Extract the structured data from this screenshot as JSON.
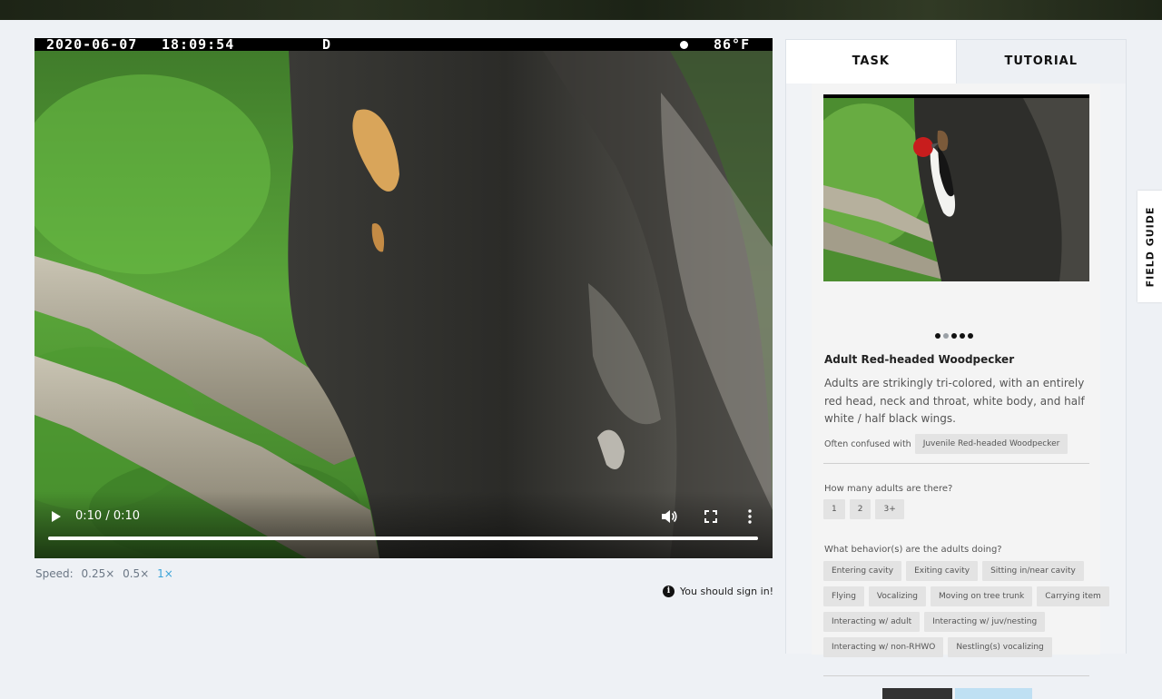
{
  "video": {
    "overlay": {
      "date": "2020-06-07",
      "time": "18:09:54",
      "mode": "D",
      "temperature": "86°F"
    },
    "player": {
      "time_display": "0:10 / 0:10",
      "progress": 1.0
    },
    "speed": {
      "label": "Speed:",
      "options": [
        "0.25×",
        "0.5×",
        "1×"
      ],
      "selected": "1×"
    }
  },
  "signin_notice": "You should sign in!",
  "tabs": [
    {
      "label": "TASK",
      "active": true
    },
    {
      "label": "TUTORIAL",
      "active": false
    }
  ],
  "task": {
    "carousel": {
      "count": 5,
      "selected_index": 1
    },
    "species_name": "Adult Red-headed Woodpecker",
    "description": "Adults are strikingly tri-colored, with an entirely red head, neck and throat, white body, and half white / half black wings.",
    "confused_label": "Often confused with",
    "confused_with": "Juvenile Red-headed Woodpecker",
    "q1": {
      "text": "How many adults are there?",
      "options": [
        "1",
        "2",
        "3+"
      ]
    },
    "q2": {
      "text": "What behavior(s) are the adults doing?",
      "rows": [
        [
          "Entering cavity",
          "Exiting cavity",
          "Sitting in/near cavity"
        ],
        [
          "Flying",
          "Vocalizing",
          "Moving on tree trunk",
          "Carrying item"
        ],
        [
          "Interacting w/ adult",
          "Interacting w/ juv/nesting"
        ],
        [
          "Interacting w/ non-RHWO",
          "Nestling(s) vocalizing"
        ]
      ]
    }
  },
  "field_guide_label": "FIELD GUIDE",
  "colors": {
    "accent": "#3aa3d8",
    "panel_bg": "#f1f3f6",
    "page_bg": "#eef1f5"
  }
}
